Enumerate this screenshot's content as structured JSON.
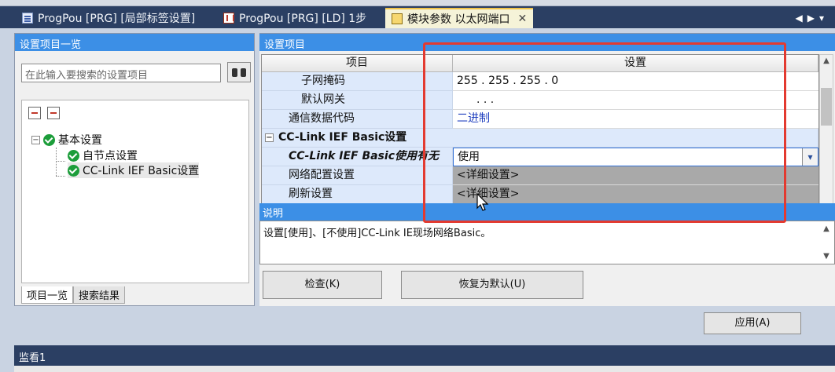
{
  "tabs": [
    {
      "label": "ProgPou [PRG] [局部标签设置]",
      "icon": "program-icon"
    },
    {
      "label": "ProgPou [PRG] [LD] 1步",
      "icon": "ladder-icon"
    },
    {
      "label": "模块参数 以太网端口",
      "icon": "module-icon",
      "active": true
    }
  ],
  "left_panel": {
    "title": "设置项目一览",
    "search_placeholder": "在此输入要搜索的设置项目",
    "tree": {
      "root": "基本设置",
      "children": [
        "自节点设置",
        "CC-Link IEF Basic设置"
      ]
    },
    "bottom_tabs": [
      "项目一览",
      "搜索结果"
    ]
  },
  "right_panel": {
    "title": "设置项目",
    "columns": {
      "item": "项目",
      "setting": "设置"
    },
    "rows": [
      {
        "item": "子网掩码",
        "setting": "255 .  255 .  255 .    0"
      },
      {
        "item": "默认网关",
        "setting": ".          .          ."
      },
      {
        "item": "通信数据代码",
        "setting": "二进制"
      },
      {
        "item": "CC-Link IEF Basic设置",
        "setting": ""
      },
      {
        "item": "CC-Link IEF Basic使用有无",
        "setting": "使用"
      },
      {
        "item": "网络配置设置",
        "setting": "<详细设置>"
      },
      {
        "item": "刷新设置",
        "setting": "<详细设置>"
      }
    ],
    "description_title": "说明",
    "description": "设置[使用]、[不使用]CC-Link IE现场网络Basic。"
  },
  "buttons": {
    "check": "检查(K)",
    "restore": "恢复为默认(U)",
    "apply": "应用(A)"
  },
  "watch": {
    "title": "监看1"
  },
  "colors": {
    "header_blue": "#3c8fe6",
    "tab_bar": "#2b3f63",
    "highlight": "#e33a30",
    "check_green": "#1c9d3a"
  }
}
